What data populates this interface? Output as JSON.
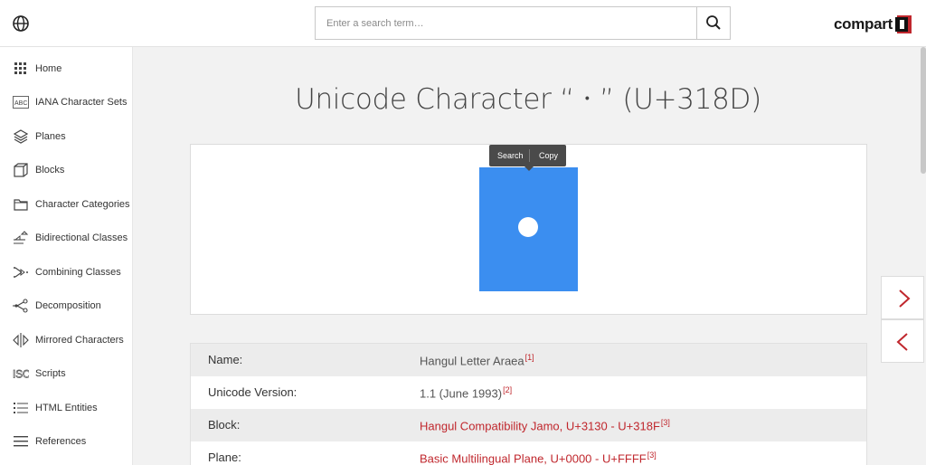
{
  "header": {
    "search_placeholder": "Enter a search term…",
    "logo_text": "compart"
  },
  "sidebar": {
    "items": [
      {
        "label": "Home",
        "icon": "grid-icon"
      },
      {
        "label": "IANA Character Sets",
        "icon": "abc-icon"
      },
      {
        "label": "Planes",
        "icon": "layers-icon"
      },
      {
        "label": "Blocks",
        "icon": "cube-icon"
      },
      {
        "label": "Character Categories",
        "icon": "folder-icon"
      },
      {
        "label": "Bidirectional Classes",
        "icon": "bidi-icon"
      },
      {
        "label": "Combining Classes",
        "icon": "combining-icon"
      },
      {
        "label": "Decomposition",
        "icon": "share-icon"
      },
      {
        "label": "Mirrored Characters",
        "icon": "mirror-icon"
      },
      {
        "label": "Scripts",
        "icon": "iso-icon"
      },
      {
        "label": "HTML Entities",
        "icon": "list-icon"
      },
      {
        "label": "References",
        "icon": "menu-icon"
      }
    ]
  },
  "main": {
    "title": "Unicode Character “ㆍ” (U+318D)",
    "tooltip": {
      "search": "Search",
      "copy": "Copy"
    },
    "glyph_color": "#3b8ef0",
    "properties": [
      {
        "key": "Name:",
        "value": "Hangul Letter Araea",
        "ref": "[1]",
        "link": false
      },
      {
        "key": "Unicode Version:",
        "value": "1.1 (June 1993)",
        "ref": "[2]",
        "link": false
      },
      {
        "key": "Block:",
        "value": "Hangul Compatibility Jamo, U+3130 - U+318F",
        "ref": "[3]",
        "link": true
      },
      {
        "key": "Plane:",
        "value": "Basic Multilingual Plane, U+0000 - U+FFFF",
        "ref": "[3]",
        "link": true
      }
    ]
  },
  "colors": {
    "accent": "#c0272d"
  }
}
